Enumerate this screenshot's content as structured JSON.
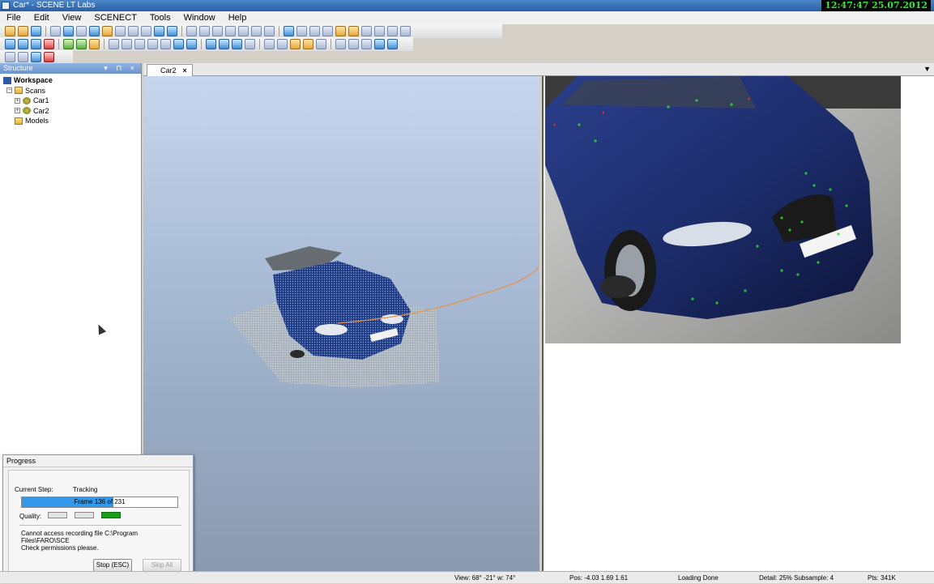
{
  "window": {
    "title": "Car* - SCENE LT Labs",
    "clock": "12:47:47 25.07.2012"
  },
  "menu": [
    "File",
    "Edit",
    "View",
    "SCENECT",
    "Tools",
    "Window",
    "Help"
  ],
  "structure": {
    "header": "Structure",
    "controls": "▾ ⊓ ×",
    "workspace": "Workspace",
    "scans": "Scans",
    "car1": "Car1",
    "car2": "Car2",
    "models": "Models"
  },
  "tabs": {
    "active": "Car2",
    "close": "×",
    "menu": "▼"
  },
  "progress": {
    "title": "Progress",
    "current_step_label": "Current Step:",
    "current_step_value": "Tracking",
    "frame_text": "Frame 136 of 231",
    "fraction": 0.5887,
    "quality_label": "Quality:",
    "message_line1": "Cannot access recording file C:\\Program Files\\FARO\\SCE",
    "message_line2": "Check permissions please.",
    "stop_button": "Stop (ESC)",
    "skip_button": "Skip All"
  },
  "status": {
    "view": "View: 68° -21° w: 74°",
    "pos": "Pos: -4.03  1.69  1.61",
    "loading": "Loading Done",
    "detail": "Detail: 25%  Subsample: 4",
    "pts": "Pts: 341K"
  }
}
